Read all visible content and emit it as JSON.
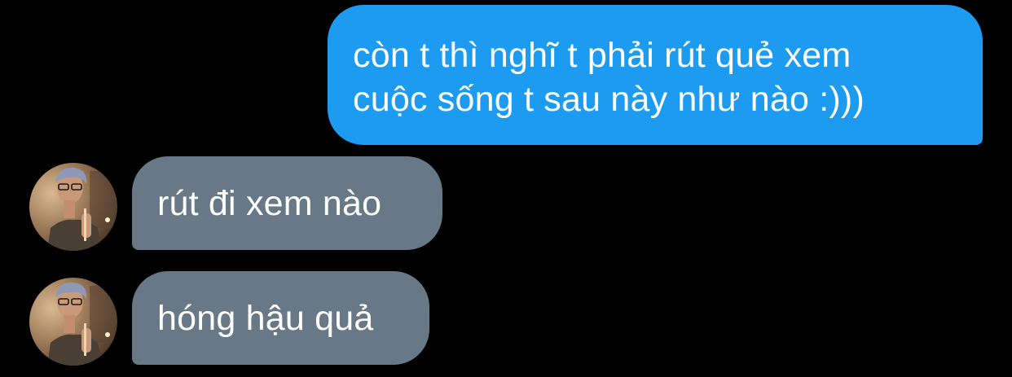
{
  "colors": {
    "background": "#000000",
    "outgoing_bubble": "#1d9bf0",
    "incoming_bubble": "#687887",
    "text": "#ffffff"
  },
  "messages": [
    {
      "direction": "outgoing",
      "lines": [
        "còn t thì nghĩ t phải rút quẻ xem",
        "cuộc sống t sau này như nào :)))"
      ]
    },
    {
      "direction": "incoming",
      "text": "rút đi xem nào",
      "avatar_icon": "user-avatar-photo"
    },
    {
      "direction": "incoming",
      "text": "hóng hậu quả",
      "avatar_icon": "user-avatar-photo"
    }
  ]
}
